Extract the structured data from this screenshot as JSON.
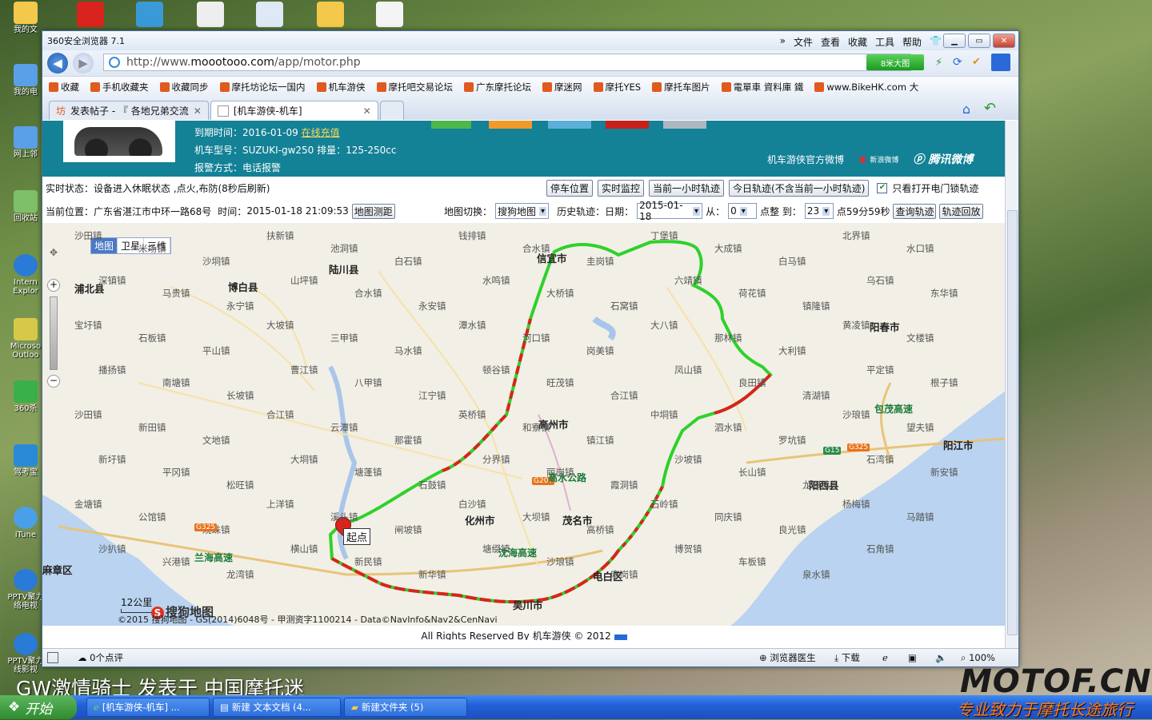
{
  "desktop": {
    "icons": [
      {
        "label": "我的文",
        "color": "#f4c84a"
      },
      {
        "label": "我的电",
        "color": "#5aa0e8"
      },
      {
        "label": "网上邻",
        "color": "#5aa0e8"
      },
      {
        "label": "回收站",
        "color": "#7ec06a"
      },
      {
        "label": "Intern Explor",
        "color": "#2a7ad8"
      },
      {
        "label": "Microso Outloo",
        "color": "#d8c84a"
      },
      {
        "label": "360杀",
        "color": "#3ab04a"
      },
      {
        "label": "驾考宝",
        "color": "#2a8ad8"
      },
      {
        "label": "iTune",
        "color": "#4aa0e8"
      },
      {
        "label": "PPTV聚力 络电视",
        "color": "#2a7ad8"
      },
      {
        "label": "PPTV聚力 线影视",
        "color": "#2a7ad8"
      }
    ]
  },
  "browser": {
    "title": "360安全浏览器 7.1",
    "menu": [
      "文件",
      "查看",
      "收藏",
      "工具",
      "帮助"
    ],
    "url_prefix": "http://www.",
    "url_domain": "moootooo.com",
    "url_path": "/app/motor.php",
    "bigmap_label": "8米大图",
    "favorites": [
      "收藏",
      "手机收藏夹",
      "收藏同步",
      "摩托坊论坛一国内",
      "机车游侠",
      "摩托吧交易论坛",
      "广东摩托论坛",
      "摩迷网",
      "摩托YES",
      "摩托车图片",
      "電單車 資料庫 鐵",
      "www.BikeHK.com 大"
    ],
    "tabs": [
      {
        "label": "发表帖子 - 『 各地兄弟交流",
        "active": false
      },
      {
        "label": "[机车游侠-机车]",
        "active": true
      }
    ]
  },
  "banner": {
    "expire_label": "到期时间：",
    "expire_date": "2016-01-09",
    "renew_link": "在线充值",
    "model_label": "机车型号：",
    "model_value": "SUZUKI-gw250 排量：125-250cc",
    "alarm_label": "报警方式：",
    "alarm_value": "电话报警",
    "weibo_label": "机车游侠官方微博",
    "sina_label": "新浪微博",
    "tencent_label": "腾讯微博"
  },
  "status": {
    "realtime_label": "实时状态：",
    "realtime_value": "设备进入休眠状态 ,点火,布防(8秒后刷新)",
    "buttons": [
      "停车位置",
      "实时监控",
      "当前一小时轨迹",
      "今日轨迹(不含当前一小时轨迹)"
    ],
    "only_open_label": "只看打开电门锁轨迹",
    "only_open_checked": true,
    "position_label": "当前位置：",
    "position_value": "广东省湛江市中环一路68号",
    "time_label": "时间：",
    "time_value": "2015-01-18 21:09:53",
    "measure_button": "地图测距",
    "map_switch_label": "地图切换：",
    "map_switch_value": "搜狗地图",
    "history_label": "历史轨迹：日期：",
    "history_date": "2015-01-18",
    "from_label": "从：",
    "from_value": "0",
    "on_the_hour": "点整 到：",
    "to_value": "23",
    "to_suffix": "点59分59秒",
    "query_button": "查询轨迹",
    "replay_button": "轨迹回放"
  },
  "map": {
    "types": [
      "地图",
      "卫星",
      "三维"
    ],
    "active_type": "地图",
    "start_marker": "起点",
    "scale": "12公里",
    "logo": "搜狗地图",
    "copyright": "©2015 搜狗地图 - GS(2014)6048号 - 甲测资字1100214 - Data©NavInfo&Nav2&CenNavi",
    "cities": [
      {
        "name": "信宜市",
        "bold": true
      },
      {
        "name": "高州市",
        "bold": true
      },
      {
        "name": "化州市",
        "bold": true
      },
      {
        "name": "茂名市",
        "bold": true
      },
      {
        "name": "电白区",
        "bold": true
      },
      {
        "name": "吴川市",
        "bold": true
      },
      {
        "name": "阳春市",
        "bold": true
      },
      {
        "name": "阳西县",
        "bold": true
      },
      {
        "name": "阳江市",
        "bold": true
      },
      {
        "name": "陆川县",
        "bold": true
      },
      {
        "name": "博白县",
        "bold": true
      },
      {
        "name": "浦北县",
        "bold": true
      },
      {
        "name": "麻章区",
        "bold": true
      }
    ],
    "towns": [
      "沙田镇",
      "米场镇",
      "沙垌镇",
      "扶新镇",
      "池洞镇",
      "白石镇",
      "钱排镇",
      "合水镇",
      "圭岗镇",
      "丁堡镇",
      "大成镇",
      "白马镇",
      "北界镇",
      "水口镇",
      "深镇镇",
      "马贵镇",
      "永宁镇",
      "山坪镇",
      "合水镇",
      "永安镇",
      "水鸣镇",
      "大桥镇",
      "石窝镇",
      "六靖镇",
      "荷花镇",
      "镇隆镇",
      "乌石镇",
      "东华镇",
      "宝圩镇",
      "石板镇",
      "平山镇",
      "大坡镇",
      "三甲镇",
      "马水镇",
      "潭水镇",
      "河口镇",
      "岗美镇",
      "大八镇",
      "那林镇",
      "大利镇",
      "黄凌镇",
      "文楼镇",
      "播扬镇",
      "南塘镇",
      "长坡镇",
      "曹江镇",
      "八甲镇",
      "江宁镇",
      "顿谷镇",
      "旺茂镇",
      "合江镇",
      "凤山镇",
      "良田镇",
      "清湖镇",
      "平定镇",
      "根子镇",
      "沙田镇",
      "新田镇",
      "文地镇",
      "合江镇",
      "云潭镇",
      "那霍镇",
      "英桥镇",
      "和寮镇",
      "镇江镇",
      "中垌镇",
      "泗水镇",
      "罗坑镇",
      "沙琅镇",
      "望夫镇",
      "新圩镇",
      "平冈镇",
      "松旺镇",
      "大垌镇",
      "塘蓬镇",
      "石鼓镇",
      "分界镇",
      "丽岗镇",
      "霞洞镇",
      "沙坡镇",
      "长山镇",
      "龙潭镇",
      "石湾镇",
      "新安镇",
      "金塘镇",
      "公馆镇",
      "观珠镇",
      "上洋镇",
      "溪头镇",
      "闸坡镇",
      "白沙镇",
      "大坝镇",
      "高桥镇",
      "石岭镇",
      "同庆镇",
      "良光镇",
      "杨梅镇",
      "马踏镇",
      "沙扒镇",
      "兴港镇",
      "龙湾镇",
      "横山镇",
      "新民镇",
      "新华镇",
      "塘缀镇",
      "沙琅镇",
      "麻岗镇",
      "博贺镇",
      "车板镇",
      "泉水镇",
      "石角镇"
    ],
    "roads": [
      "G15",
      "G325",
      "G207",
      "G325",
      "兰海高速",
      "沈海高速",
      "包茂高速",
      "高水公路"
    ]
  },
  "footer": "All Rights Reserved By 机车游侠 © 2012",
  "statusbar": {
    "points": "0个点评",
    "doctor": "浏览器医生",
    "download": "下载",
    "zoom": "100%"
  },
  "taskbar": {
    "start": "开始",
    "items": [
      "[机车游侠-机车] ...",
      "新建 文本文档 (4...",
      "新建文件夹 (5)"
    ]
  },
  "watermark": {
    "caption": "GW激情骑士 发表于 中国摩托迷",
    "brand": "MOTOF.CN",
    "slogan": "专业致力于摩托长途旅行"
  },
  "colors": {
    "banner_bg": "#138196",
    "route_green": "#2ed12a",
    "route_red": "#d8241c",
    "link_yellow": "#ffd85a"
  }
}
